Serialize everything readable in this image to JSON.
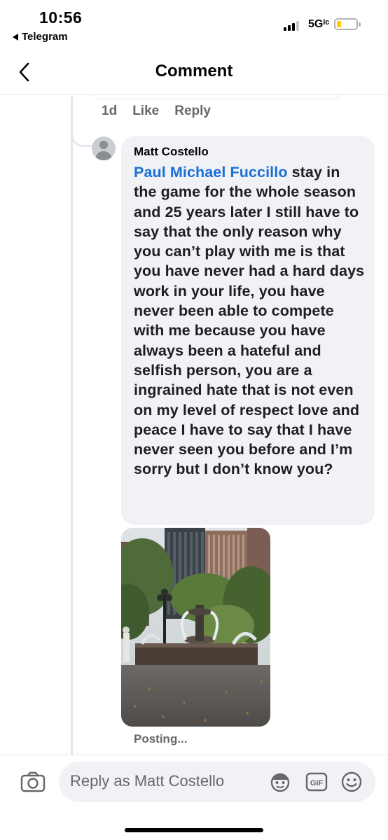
{
  "status_bar": {
    "time": "10:56",
    "back_app": "Telegram",
    "network": "5Gᴵᶜ",
    "signal_bars": 4,
    "signal_filled": 3
  },
  "header": {
    "title": "Comment",
    "back_icon": "chevron-left-icon"
  },
  "parent_comment_meta": {
    "time": "1d",
    "like_label": "Like",
    "reply_label": "Reply"
  },
  "reply": {
    "author": "Matt Costello",
    "mention": "Paul Michael Fuccillo",
    "text": " stay in the game for the whole season and 25 years later I still have to say that the only reason why you can’t play with me is that you have never had a hard days work in your life, you have never been able to compete with me because you have always been a hateful and selfish person, you are a ingrained hate that is not even on my level of respect love and peace I have to say that I have never seen you before and I’m sorry but I don’t know you?",
    "status": "Posting..."
  },
  "composer": {
    "placeholder": "Reply as Matt Costello",
    "icons": [
      "camera-icon",
      "avatar-sticker-icon",
      "gif-icon",
      "emoji-icon"
    ]
  },
  "colors": {
    "mention": "#1a6fd6",
    "bubble_bg": "#f0f2f5",
    "secondary_text": "#65676b",
    "battery": "#ffcc00"
  }
}
